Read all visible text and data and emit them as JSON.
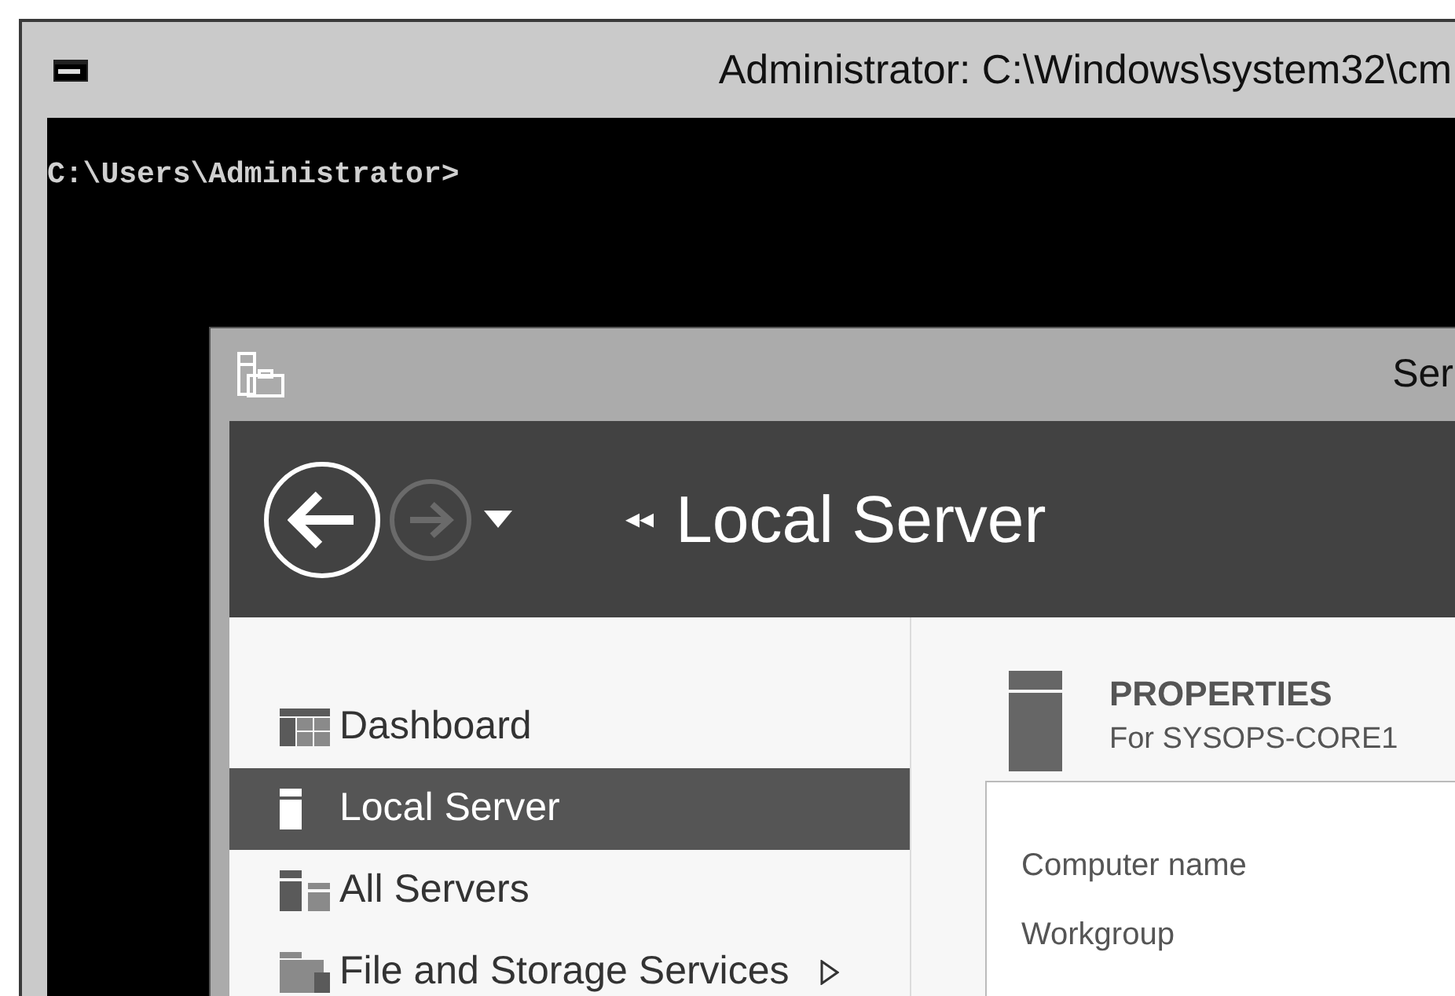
{
  "console_window": {
    "title": "Administrator: C:\\Windows\\system32\\cm",
    "prompt": "C:\\Users\\Administrator>"
  },
  "server_manager": {
    "title": "Ser",
    "breadcrumb_marker": "◂◂",
    "header": "Local Server",
    "nav": [
      {
        "label": "Dashboard",
        "kind": "dashboard",
        "selected": false,
        "submenu": false
      },
      {
        "label": "Local Server",
        "kind": "local",
        "selected": true,
        "submenu": false
      },
      {
        "label": "All Servers",
        "kind": "all",
        "selected": false,
        "submenu": false
      },
      {
        "label": "File and Storage Services",
        "kind": "storage",
        "selected": false,
        "submenu": true
      }
    ],
    "properties": {
      "title": "PROPERTIES",
      "subtitle": "For SYSOPS-CORE1",
      "fields": [
        "Computer name",
        "Workgroup"
      ]
    }
  }
}
